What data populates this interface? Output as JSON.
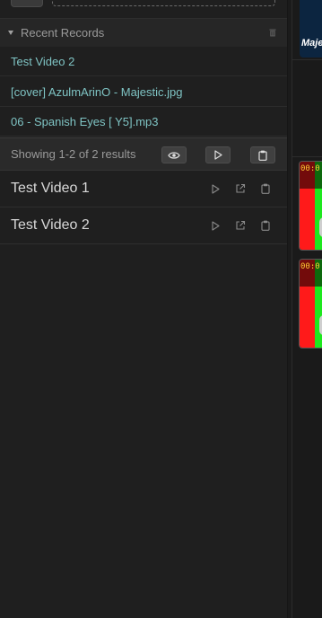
{
  "recent": {
    "title": "Recent Records",
    "items": [
      {
        "label": "Test Video 2"
      },
      {
        "label": "[cover] AzulmArinO - Majestic.jpg"
      },
      {
        "label": "06 - Spanish Eyes [ Y5].mp3"
      }
    ]
  },
  "results": {
    "summary": "Showing 1-2 of 2 results"
  },
  "rows": [
    {
      "title": "Test Video 1"
    },
    {
      "title": "Test Video 2"
    }
  ],
  "preview": {
    "cover_text": "Maje",
    "timecode": "00:0"
  },
  "colors": {
    "accent_teal": "#7fc4c4",
    "thumb_red": "#ff1a1a",
    "thumb_green": "#1ee81e",
    "cover_navy": "#0c2540"
  },
  "icons": {
    "collapse": "caret-down-icon",
    "clear": "trash-icon",
    "view": "eye-icon",
    "play": "play-icon",
    "open": "external-link-icon",
    "copy": "clipboard-icon"
  }
}
